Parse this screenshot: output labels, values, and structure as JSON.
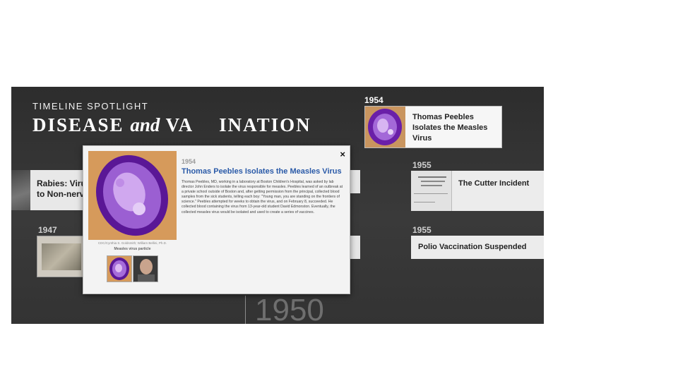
{
  "header": {
    "kicker": "TIMELINE SPOTLIGHT",
    "title_part1": "DISEASE",
    "title_and": "and",
    "title_part2": "VA",
    "title_part3": "INATION"
  },
  "cards": {
    "rabies": {
      "label_line1": "Rabies: Virus",
      "label_line2": "to Non-nervo"
    },
    "year_1947": "1947",
    "peebles": {
      "year": "1954",
      "label_line1": "Thomas Peebles",
      "label_line2": "Isolates the Measles",
      "label_line3": "Virus"
    },
    "cutter": {
      "year": "1955",
      "label": "The Cutter Incident"
    },
    "polio": {
      "year": "1955",
      "label": "Polio Vaccination Suspended"
    }
  },
  "axis": {
    "decade_label": "1950"
  },
  "modal": {
    "year": "1954",
    "title": "Thomas Peebles Isolates the Measles Virus",
    "close": "×",
    "body": "Thomas Peebles, MD, working in a laboratory at Boston Children's Hospital, was asked by lab director John Enders to isolate the virus responsible for measles. Peebles learned of an outbreak at a private school outside of Boston and, after getting permission from the principal, collected blood samples from the sick students, telling each boy: \"Young man, you are standing on the frontiers of science.\" Peebles attempted for weeks to obtain the virus, and on February 8, succeeded. He collected blood containing the virus from 13-year-old student David Edmonston. Eventually, the collected measles virus would be isolated and used to create a series of vaccines.",
    "image_credit": "CDC/Cynthia S. Goldsmith; William Bellini, Ph.D.",
    "image_caption": "Measles virus particle"
  },
  "colors": {
    "accent_link": "#2a5aa8",
    "virus_purple": "#7b2fb5",
    "background": "#333333"
  }
}
